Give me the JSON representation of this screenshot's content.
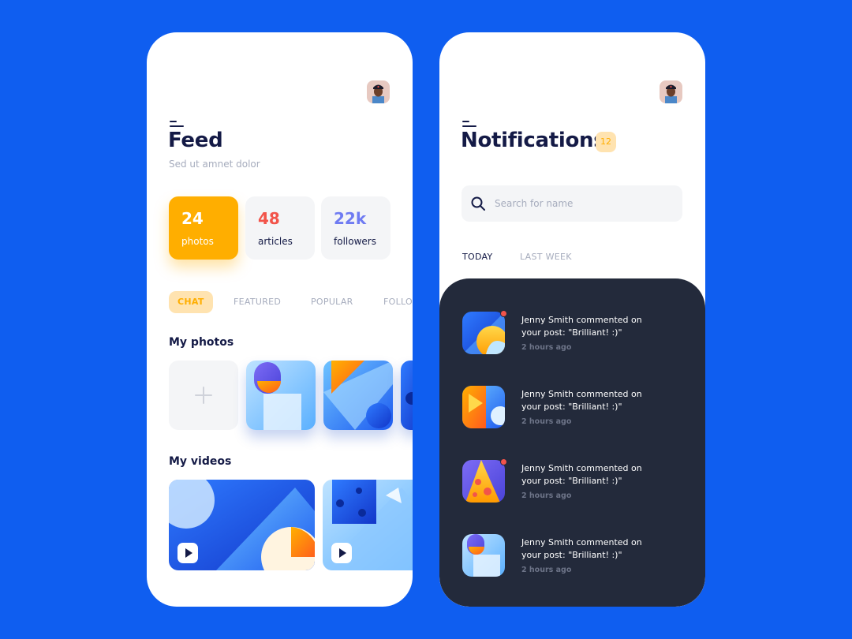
{
  "feed_screen": {
    "title": "Feed",
    "subtitle": "Sed ut amnet dolor",
    "stats": [
      {
        "value": "24",
        "label": "photos"
      },
      {
        "value": "48",
        "label": "articles"
      },
      {
        "value": "22k",
        "label": "followers"
      }
    ],
    "tabs": [
      "CHAT",
      "FEATURED",
      "POPULAR",
      "FOLLO"
    ],
    "active_tab": "CHAT",
    "my_photos_title": "My photos",
    "my_videos_title": "My videos",
    "icons": {
      "menu": "menu-icon",
      "add": "plus-icon",
      "play": "play-icon"
    }
  },
  "notifications_screen": {
    "title": "Notifications",
    "count": "12",
    "search": {
      "placeholder": "Search for name",
      "value": ""
    },
    "tabs": [
      "TODAY",
      "LAST WEEK"
    ],
    "active_tab": "TODAY",
    "items": [
      {
        "text": "Jenny Smith commented on your post: \"Brilliant! :)\"",
        "time": "2 hours ago",
        "unread": true
      },
      {
        "text": "Jenny Smith commented on your post: \"Brilliant! :)\"",
        "time": "2 hours ago",
        "unread": false
      },
      {
        "text": "Jenny Smith commented on your post: \"Brilliant! :)\"",
        "time": "2 hours ago",
        "unread": true
      },
      {
        "text": "Jenny Smith commented on your post: \"Brilliant! :)\"",
        "time": "2 hours ago",
        "unread": false
      }
    ]
  },
  "colors": {
    "background": "#0f5ef0",
    "accent_orange": "#ffae00",
    "accent_red": "#f2544a",
    "accent_purple": "#6f7bf2",
    "navy": "#141a46",
    "dark_panel": "#232a3b"
  }
}
